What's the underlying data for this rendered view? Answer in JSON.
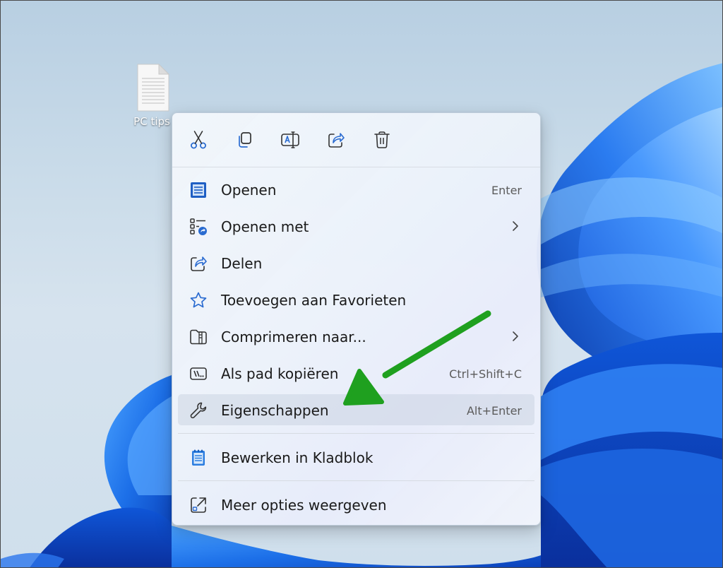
{
  "desktop": {
    "file_icon": {
      "label": "PC tips",
      "icon": "text-file-icon"
    }
  },
  "toolbar": {
    "buttons": [
      {
        "name": "cut",
        "icon": "scissors-icon"
      },
      {
        "name": "copy",
        "icon": "copy-icon"
      },
      {
        "name": "rename",
        "icon": "rename-icon"
      },
      {
        "name": "share",
        "icon": "share-icon"
      },
      {
        "name": "delete",
        "icon": "trash-icon"
      }
    ]
  },
  "menu": {
    "items": [
      {
        "label": "Openen",
        "shortcut": "Enter",
        "icon": "notepad-icon"
      },
      {
        "label": "Openen met",
        "shortcut": "",
        "icon": "open-with-icon",
        "submenu": true
      },
      {
        "label": "Delen",
        "shortcut": "",
        "icon": "share-icon"
      },
      {
        "label": "Toevoegen aan Favorieten",
        "shortcut": "",
        "icon": "star-icon"
      },
      {
        "label": "Comprimeren naar...",
        "shortcut": "",
        "icon": "zip-folder-icon",
        "submenu": true
      },
      {
        "label": "Als pad kopiëren",
        "shortcut": "Ctrl+Shift+C",
        "icon": "copy-path-icon"
      },
      {
        "label": "Eigenschappen",
        "shortcut": "Alt+Enter",
        "icon": "wrench-icon",
        "highlighted": true
      },
      {
        "label": "Bewerken in Kladblok",
        "shortcut": "",
        "icon": "notepad-icon"
      },
      {
        "label": "Meer opties weergeven",
        "shortcut": "",
        "icon": "open-external-icon"
      }
    ]
  },
  "colors": {
    "accent": "#2564c7",
    "arrow": "#1fa01f",
    "wallpaper_blue": "#1565e8"
  }
}
